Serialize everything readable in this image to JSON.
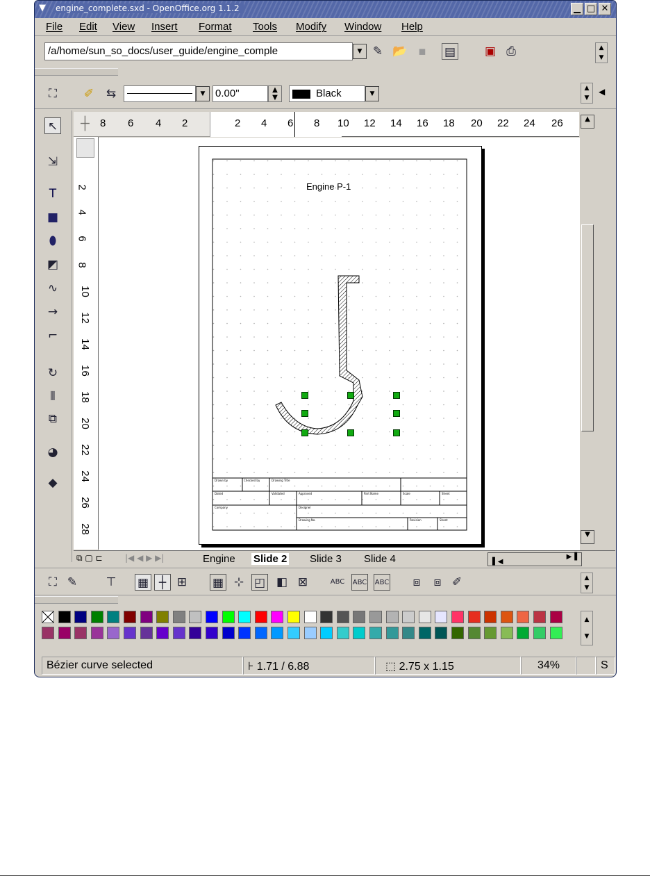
{
  "window": {
    "title": "engine_complete.sxd - OpenOffice.org 1.1.2"
  },
  "menu": [
    "File",
    "Edit",
    "View",
    "Insert",
    "Format",
    "Tools",
    "Modify",
    "Window",
    "Help"
  ],
  "function_bar": {
    "path": "/a/home/sun_so_docs/user_guide/engine_comple"
  },
  "object_bar": {
    "line_width": "0.00\"",
    "line_color": "Black",
    "line_color_hex": "#000000"
  },
  "ruler_h": [
    "8",
    "6",
    "4",
    "2",
    "2",
    "4",
    "6",
    "8",
    "10",
    "12",
    "14",
    "16",
    "18",
    "20",
    "22",
    "24",
    "26"
  ],
  "ruler_v": [
    "2",
    "4",
    "6",
    "8",
    "10",
    "12",
    "14",
    "16",
    "18",
    "20",
    "22",
    "24",
    "26",
    "28"
  ],
  "drawing": {
    "title": "Engine P-1",
    "title_block": [
      "Drawn by",
      "Checked by",
      "Drawing Title",
      "Dated",
      "Validated",
      "Approved",
      "Part Name",
      "Scale",
      "Sheet",
      "Company",
      "Designer",
      "Drawing No.",
      "Revision",
      "Sheet"
    ]
  },
  "tabs": [
    {
      "label": "Engine",
      "active": false
    },
    {
      "label": "Slide 2",
      "active": true
    },
    {
      "label": "Slide 3",
      "active": false
    },
    {
      "label": "Slide 4",
      "active": false
    }
  ],
  "palette_row1": [
    "none",
    "#000000",
    "#000080",
    "#008000",
    "#008080",
    "#800000",
    "#800080",
    "#808000",
    "#808080",
    "#c0c0c0",
    "#0000ff",
    "#00ff00",
    "#00ffff",
    "#ff0000",
    "#ff00ff",
    "#ffff00",
    "#ffffff",
    "#333333",
    "#555555",
    "#777777",
    "#999999",
    "#b3b3b3",
    "#cccccc",
    "#e6e6e6",
    "#e6e6ff",
    "#ff3366",
    "#e62e1f",
    "#cc3300",
    "#dd5511",
    "#ee6644",
    "#bb3344",
    "#aa0044"
  ],
  "palette_row2": [
    "#993366",
    "#990066",
    "#993366",
    "#993399",
    "#9966cc",
    "#6633cc",
    "#663399",
    "#6600cc",
    "#6633cc",
    "#330099",
    "#3300cc",
    "#0000cc",
    "#0033ff",
    "#0066ff",
    "#0099ff",
    "#33ccff",
    "#99ccff",
    "#00ccff",
    "#33cccc",
    "#00cccc",
    "#33aaaa",
    "#339999",
    "#338888",
    "#006666",
    "#005555",
    "#336600",
    "#558833",
    "#669933",
    "#88bb55",
    "#00aa33",
    "#33cc66",
    "#33ee55"
  ],
  "status": {
    "message": "Bézier curve selected",
    "position": "1.71 / 6.88",
    "size": "2.75 x 1.15",
    "zoom": "34%",
    "mode": "S"
  }
}
